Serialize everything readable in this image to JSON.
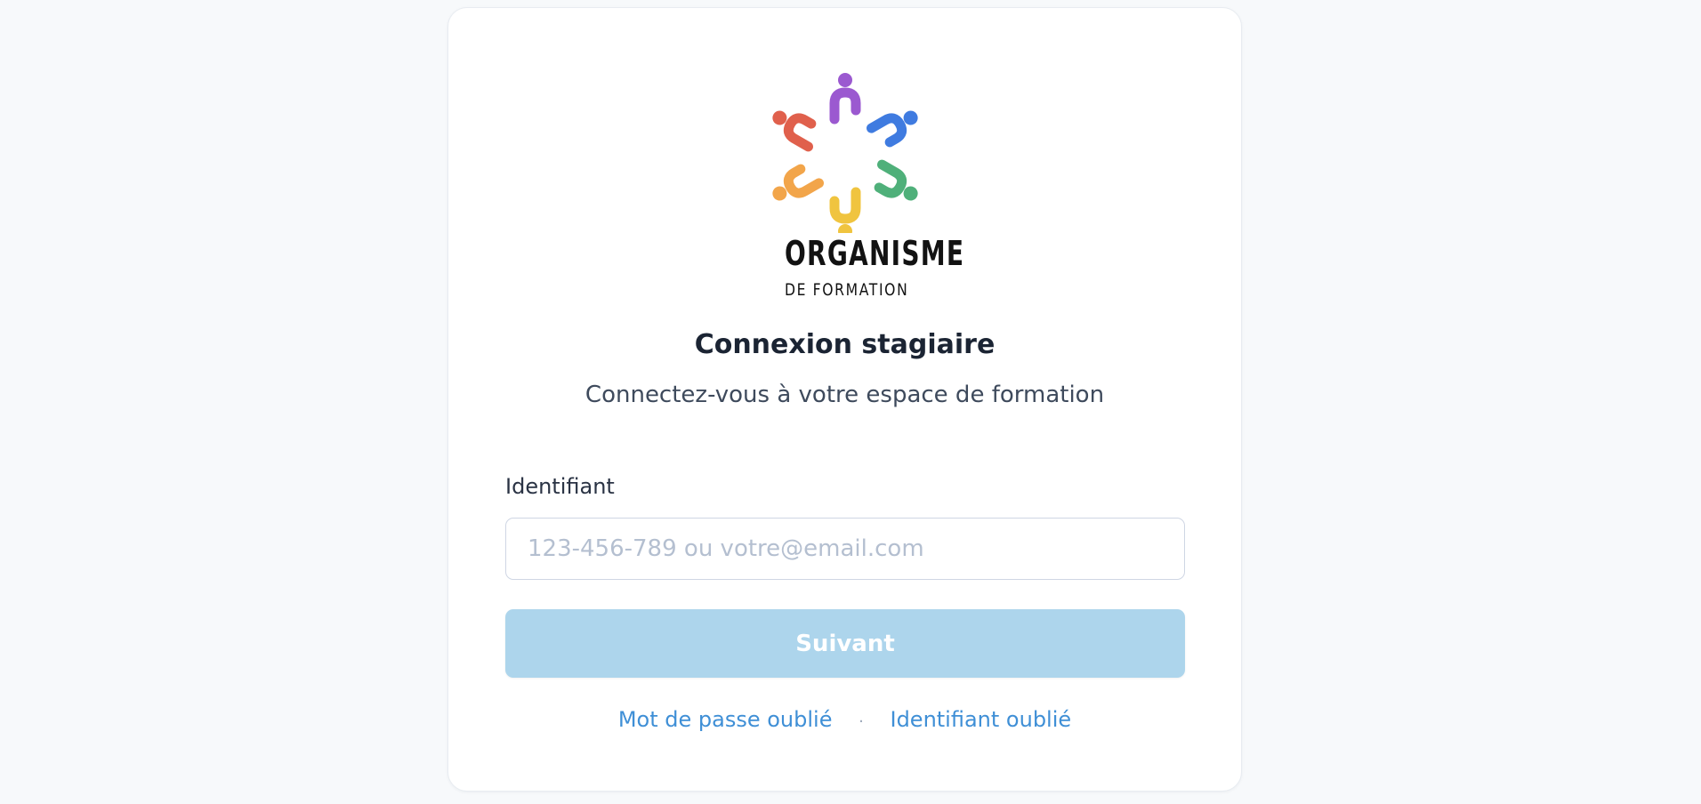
{
  "brand": {
    "name_line1": "ORGANISME",
    "name_line2": "DE FORMATION",
    "logo_colors": [
      "#9b59d0",
      "#3f7be0",
      "#4fb07a",
      "#f0c43f",
      "#f2a54a",
      "#e0604c"
    ]
  },
  "login": {
    "title": "Connexion stagiaire",
    "subtitle": "Connectez-vous à votre espace de formation",
    "identifier_label": "Identifiant",
    "identifier_value": "",
    "identifier_placeholder": "123-456-789 ou votre@email.com",
    "submit_label": "Suivant",
    "submit_enabled": false
  },
  "links": {
    "forgot_password": "Mot de passe oublié",
    "separator": "·",
    "forgot_identifier": "Identifiant oublié"
  },
  "colors": {
    "accent": "#3f8fd6",
    "button_disabled": "#add5ec",
    "background": "#f7f9fb"
  }
}
